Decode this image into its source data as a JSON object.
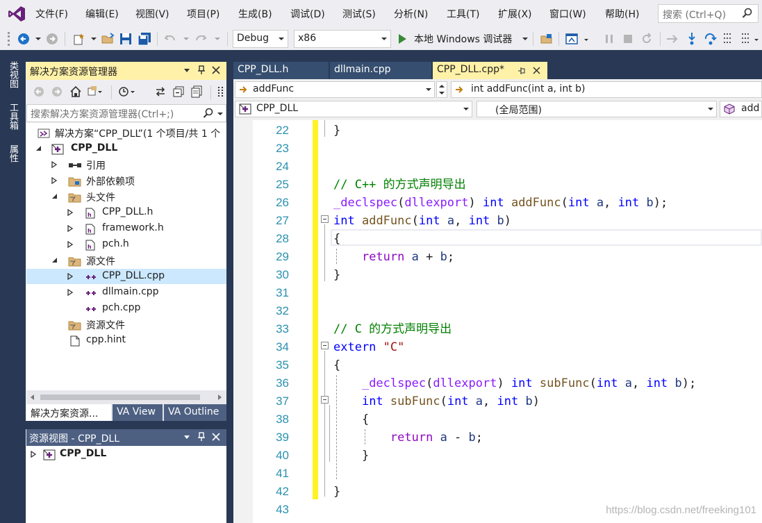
{
  "menu": {
    "items": [
      "文件(F)",
      "编辑(E)",
      "视图(V)",
      "项目(P)",
      "生成(B)",
      "调试(D)",
      "测试(S)",
      "分析(N)",
      "工具(T)",
      "扩展(X)",
      "窗口(W)",
      "帮助(H)"
    ],
    "search_placeholder": "搜索 (Ctrl+Q)"
  },
  "toolbar": {
    "config": "Debug",
    "platform": "x86",
    "debugger_label": "本地 Windows 调试器"
  },
  "left_tabs": [
    "类视图",
    "工具箱",
    "属性"
  ],
  "solution_explorer": {
    "title": "解决方案资源管理器",
    "search_placeholder": "搜索解决方案资源管理器(Ctrl+;)",
    "tree": [
      {
        "label": "解决方案“CPP_DLL”(1 个项目/共 1 个",
        "icon": "solution-icon"
      },
      {
        "label": "CPP_DLL",
        "icon": "project-icon"
      },
      {
        "label": "引用",
        "icon": "references-icon"
      },
      {
        "label": "外部依赖项",
        "icon": "folder-icon"
      },
      {
        "label": "头文件",
        "icon": "filter-folder-icon"
      },
      {
        "label": "CPP_DLL.h",
        "icon": "header-file-icon"
      },
      {
        "label": "framework.h",
        "icon": "header-file-icon"
      },
      {
        "label": "pch.h",
        "icon": "header-file-icon"
      },
      {
        "label": "源文件",
        "icon": "filter-folder-icon"
      },
      {
        "label": "CPP_DLL.cpp",
        "icon": "cpp-file-icon"
      },
      {
        "label": "dllmain.cpp",
        "icon": "cpp-file-icon"
      },
      {
        "label": "pch.cpp",
        "icon": "cpp-file-icon"
      },
      {
        "label": "资源文件",
        "icon": "filter-folder-icon"
      },
      {
        "label": "cpp.hint",
        "icon": "file-icon"
      }
    ],
    "tabs": [
      "解决方案资源...",
      "VA View",
      "VA Outline"
    ]
  },
  "resource_view": {
    "title": "资源视图 - CPP_DLL",
    "root": "CPP_DLL"
  },
  "document_tabs": [
    "CPP_DLL.h",
    "dllmain.cpp",
    "CPP_DLL.cpp*"
  ],
  "nav": {
    "member": "addFunc",
    "signature": "int addFunc(int a, int b)",
    "project": "CPP_DLL",
    "scope": "(全局范围)",
    "right": "add"
  },
  "code": {
    "line_numbers": [
      "22",
      "23",
      "24",
      "25",
      "26",
      "27",
      "28",
      "29",
      "30",
      "31",
      "32",
      "33",
      "34",
      "35",
      "36",
      "37",
      "38",
      "39",
      "40",
      "41",
      "42",
      "43"
    ],
    "lines": {
      "l22": "}",
      "l25": "// C++ 的方式声明导出",
      "l33": "// C 的方式声明导出",
      "declspec": "_declspec",
      "dllexport": "dllexport",
      "int": "int",
      "addFunc": "addFunc",
      "subFunc": "subFunc",
      "a": "a",
      "b": "b",
      "return": "return",
      "extern": "extern",
      "C": "\"C\""
    }
  },
  "watermark": "https://blog.csdn.net/freeking101"
}
